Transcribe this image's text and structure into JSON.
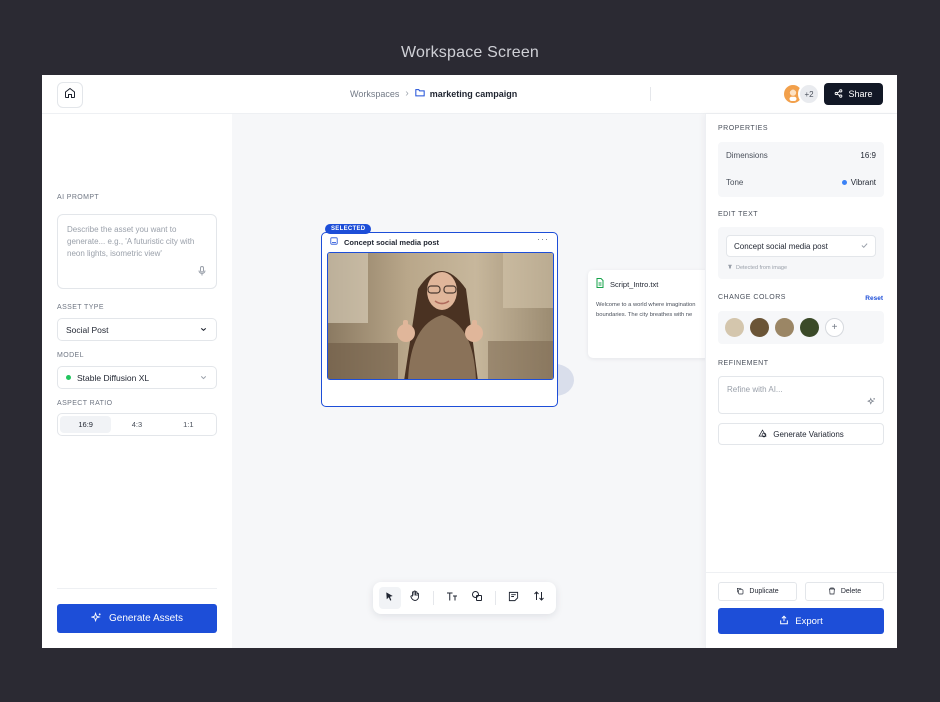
{
  "caption": "Workspace Screen",
  "header": {
    "breadcrumb_root": "Workspaces",
    "breadcrumb_sep": "›",
    "breadcrumb_current": "marketing campaign",
    "avatar_more": "+2",
    "share_label": "Share"
  },
  "left": {
    "prompt_label": "AI PROMPT",
    "prompt_placeholder": "Describe the asset you want to generate... e.g., 'A futuristic city with neon lights, isometric view'",
    "asset_type_label": "ASSET TYPE",
    "asset_type_value": "Social Post",
    "model_label": "MODEL",
    "model_value": "Stable Diffusion XL",
    "aspect_label": "ASPECT RATIO",
    "aspect_options": [
      "16:9",
      "4:3",
      "1:1"
    ],
    "aspect_selected": "16:9",
    "generate_label": "Generate Assets"
  },
  "canvas": {
    "selected_badge": "SELECTED",
    "card_title": "Concept social media post",
    "card_more": "···",
    "doc_title": "Script_Intro.txt",
    "doc_line1": "Welcome to a world where imagination",
    "doc_line2": "boundaries. The city breathes with ne"
  },
  "right": {
    "properties_label": "PROPERTIES",
    "dimensions_label": "Dimensions",
    "dimensions_value": "16:9",
    "tone_label": "Tone",
    "tone_value": "Vibrant",
    "edit_text_label": "EDIT TEXT",
    "edit_text_value": "Concept social media post",
    "detected_note": "Detected from image",
    "change_colors_label": "CHANGE COLORS",
    "reset_label": "Reset",
    "swatches": [
      "#d4c6ad",
      "#6b5537",
      "#9b8665",
      "#3b4a28"
    ],
    "refinement_label": "REFINEMENT",
    "refine_placeholder": "Refine with AI...",
    "variations_label": "Generate Variations",
    "duplicate_label": "Duplicate",
    "delete_label": "Delete",
    "export_label": "Export"
  },
  "colors": {
    "accent": "#1d4ed8",
    "dark_button": "#121826",
    "background": "#2b2a33"
  }
}
